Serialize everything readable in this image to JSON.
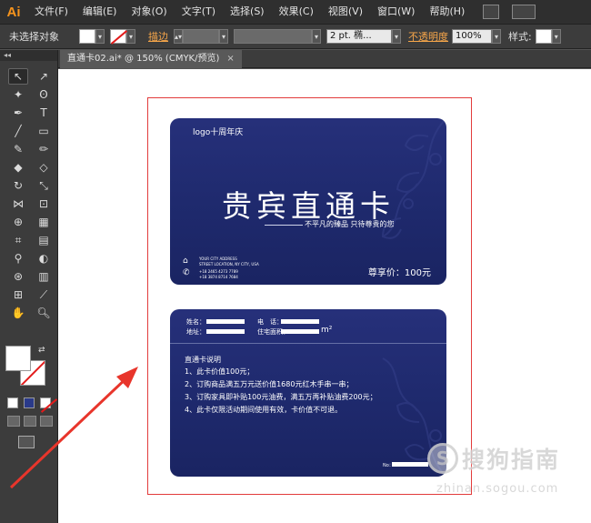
{
  "app": {
    "logo": "Ai"
  },
  "menu": [
    "文件(F)",
    "编辑(E)",
    "对象(O)",
    "文字(T)",
    "选择(S)",
    "效果(C)",
    "视图(V)",
    "窗口(W)",
    "帮助(H)"
  ],
  "control_bar": {
    "selection_status": "未选择对象",
    "stroke_label": "描边",
    "stroke_profile": "2 pt. 椭...",
    "opacity_label": "不透明度",
    "opacity_value": "100%",
    "style_label": "样式:",
    "dropdown_arrow": "▾",
    "spinner_arrows": "▴▾"
  },
  "toolbar": {
    "header": "◂◂",
    "tools": [
      {
        "name": "selection-tool",
        "glyph": "↖",
        "selected": true
      },
      {
        "name": "direct-selection-tool",
        "glyph": "↗"
      },
      {
        "name": "magic-wand-tool",
        "glyph": "✦"
      },
      {
        "name": "lasso-tool",
        "glyph": "ʘ"
      },
      {
        "name": "pen-tool",
        "glyph": "✒"
      },
      {
        "name": "type-tool",
        "glyph": "T"
      },
      {
        "name": "line-tool",
        "glyph": "╱"
      },
      {
        "name": "rectangle-tool",
        "glyph": "▭"
      },
      {
        "name": "paintbrush-tool",
        "glyph": "✎"
      },
      {
        "name": "pencil-tool",
        "glyph": "✏"
      },
      {
        "name": "blob-brush-tool",
        "glyph": "◆"
      },
      {
        "name": "eraser-tool",
        "glyph": "◇"
      },
      {
        "name": "rotate-tool",
        "glyph": "↻"
      },
      {
        "name": "scale-tool",
        "glyph": "⤡"
      },
      {
        "name": "width-tool",
        "glyph": "⋈"
      },
      {
        "name": "free-transform-tool",
        "glyph": "⊡"
      },
      {
        "name": "shape-builder-tool",
        "glyph": "⊕"
      },
      {
        "name": "perspective-grid-tool",
        "glyph": "▦"
      },
      {
        "name": "mesh-tool",
        "glyph": "⌗"
      },
      {
        "name": "gradient-tool",
        "glyph": "▤"
      },
      {
        "name": "eyedropper-tool",
        "glyph": "⚲"
      },
      {
        "name": "blend-tool",
        "glyph": "◐"
      },
      {
        "name": "symbol-sprayer-tool",
        "glyph": "⊛"
      },
      {
        "name": "column-graph-tool",
        "glyph": "▥"
      },
      {
        "name": "artboard-tool",
        "glyph": "⊞"
      },
      {
        "name": "slice-tool",
        "glyph": "⟋"
      },
      {
        "name": "hand-tool",
        "glyph": "✋"
      },
      {
        "name": "zoom-tool",
        "glyph": "🔍︎"
      }
    ],
    "swap_icon": "⇄"
  },
  "document_tab": {
    "title": "直通卡02.ai* @ 150% (CMYK/预览)",
    "close": "×"
  },
  "card_front": {
    "logo_text": "logo十周年庆",
    "title": "贵宾直通卡",
    "slogan": "不平凡的臻品 只待尊贵的您",
    "address_lines": [
      "YOUR CITY ADDRESS",
      "STREET LOCATION, NY CITY, USA",
      "+18 2465 4273 7789",
      "+18 3874 8714 7684"
    ],
    "price": "尊享价：100元"
  },
  "card_back": {
    "name_label": "姓名：",
    "phone_label": "电　话：",
    "address_label": "地址：",
    "area_label": "住宅面积：",
    "area_unit": "m²",
    "terms_title": "直通卡说明",
    "terms": [
      "1、此卡价值100元；",
      "2、订购商品满五万元送价值1680元红木手串一串；",
      "3、订购家具即补贴100元油费，满五万再补贴油费200元；",
      "4、此卡仅限活动期间使用有效，卡价值不可退。"
    ],
    "sign_label": "No："
  },
  "watermark": {
    "icon": "S",
    "text": "搜狗指南",
    "url": "zhinan.sogou.com"
  },
  "colors": {
    "card_blue": "#232d74",
    "arrow_red": "#e8352b",
    "artboard_border": "#e23b3b",
    "accent_orange": "#f7941d"
  }
}
